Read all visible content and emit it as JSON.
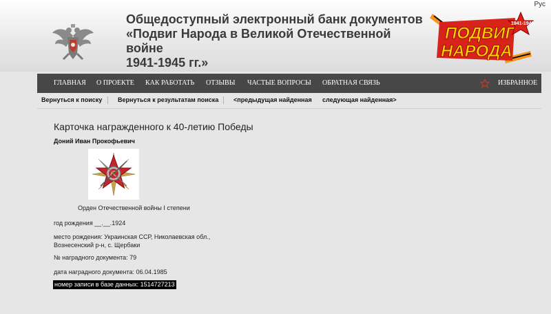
{
  "header": {
    "lang": "Рус",
    "title_line1": "Общедоступный электронный банк документов",
    "title_line2": "«Подвиг Народа в Великой Отечественной войне",
    "title_line3": "1941-1945 гг.»",
    "logo_text_1": "ПОДВИГ",
    "logo_text_2": "НАРОДА",
    "logo_years": "1941-1945"
  },
  "nav": {
    "items": [
      "ГЛАВНАЯ",
      "О ПРОЕКТЕ",
      "КАК РАБОТАТЬ",
      "ОТЗЫВЫ",
      "ЧАСТЫЕ ВОПРОСЫ",
      "ОБРАТНАЯ СВЯЗЬ"
    ],
    "favorites": "ИЗБРАННОЕ"
  },
  "subnav": {
    "back_to_search": "Вернуться к поиску",
    "back_to_results": "Вернуться к результатам поиска",
    "prev_found": "<предыдущая найденная",
    "next_found": "следующая найденная>"
  },
  "card": {
    "title": "Карточка награжденного к 40-летию Победы",
    "name": "Доний Иван Прокофьевич",
    "medal_caption": "Орден Отечественной войны I степени",
    "birth_date": "год рождения __.__.1924",
    "birth_place_1": "место рождения: Украинская ССР, Николаевская обл.,",
    "birth_place_2": "Вознесенский р-н, с. Щербаки",
    "award_doc_number": "№ наградного документа: 79",
    "award_doc_date": "дата наградного документа: 06.04.1985",
    "record_number": "номер записи в базе данных: 1514727213"
  },
  "colors": {
    "nav_bg": "#474747",
    "page_bg": "#e6e6e6",
    "star": "#c0392b",
    "logo_red": "#d8231a",
    "logo_orange": "#f7941d"
  }
}
